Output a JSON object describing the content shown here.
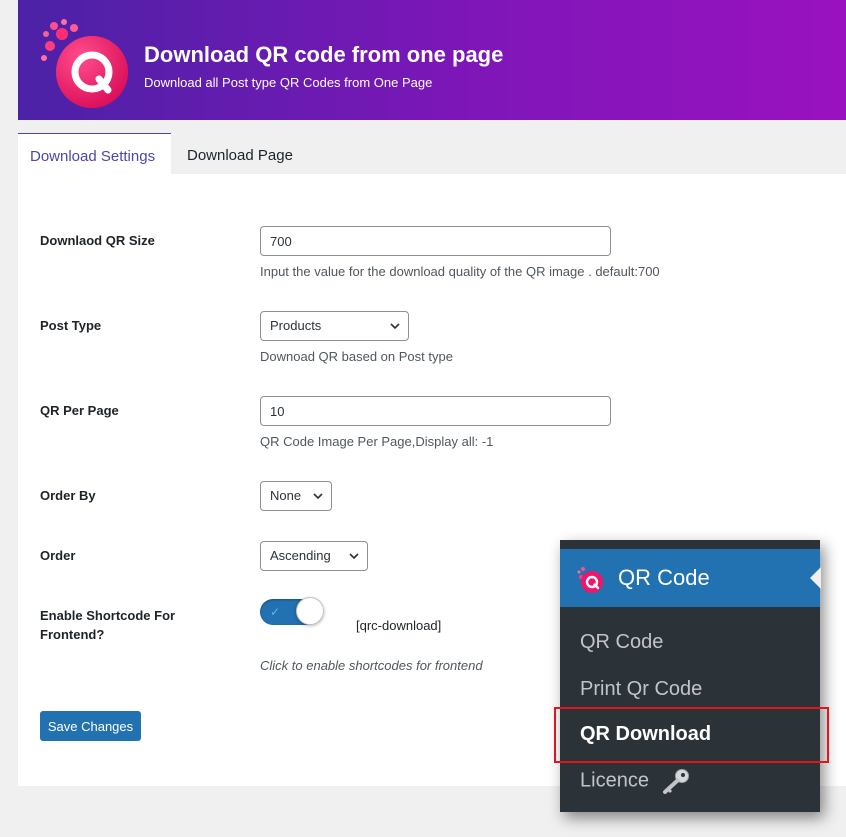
{
  "header": {
    "title": "Download QR code from one page",
    "subtitle": "Download all Post type QR Codes from One Page",
    "gradient_start": "#4b22a6",
    "gradient_end": "#9a12c0"
  },
  "tabs": [
    {
      "label": "Download Settings",
      "active": true
    },
    {
      "label": "Download Page",
      "active": false
    }
  ],
  "form": {
    "qr_size": {
      "label": "Downlaod QR Size",
      "value": "700",
      "description": "Input the value for the download quality of the QR image . default:700"
    },
    "post_type": {
      "label": "Post Type",
      "selected": "Products",
      "description": "Downoad QR based on Post type"
    },
    "per_page": {
      "label": "QR Per Page",
      "value": "10",
      "description": "QR Code Image Per Page,Display all: -1"
    },
    "order_by": {
      "label": "Order By",
      "selected": "None"
    },
    "order": {
      "label": "Order",
      "selected": "Ascending"
    },
    "shortcode": {
      "label_line1": "Enable Shortcode For",
      "label_line2": "Frontend?",
      "enabled": true,
      "code": "[qrc-download]",
      "description": "Click to enable shortcodes for frontend"
    },
    "save_label": "Save Changes"
  },
  "menu": {
    "title": "QR Code",
    "items": [
      {
        "label": "QR Code"
      },
      {
        "label": "Print Qr Code"
      },
      {
        "label": "QR Download",
        "current": true
      },
      {
        "label": "Licence",
        "icon": "key-icon"
      }
    ],
    "accent": "#2271b1",
    "highlight_color": "#e3151b"
  }
}
